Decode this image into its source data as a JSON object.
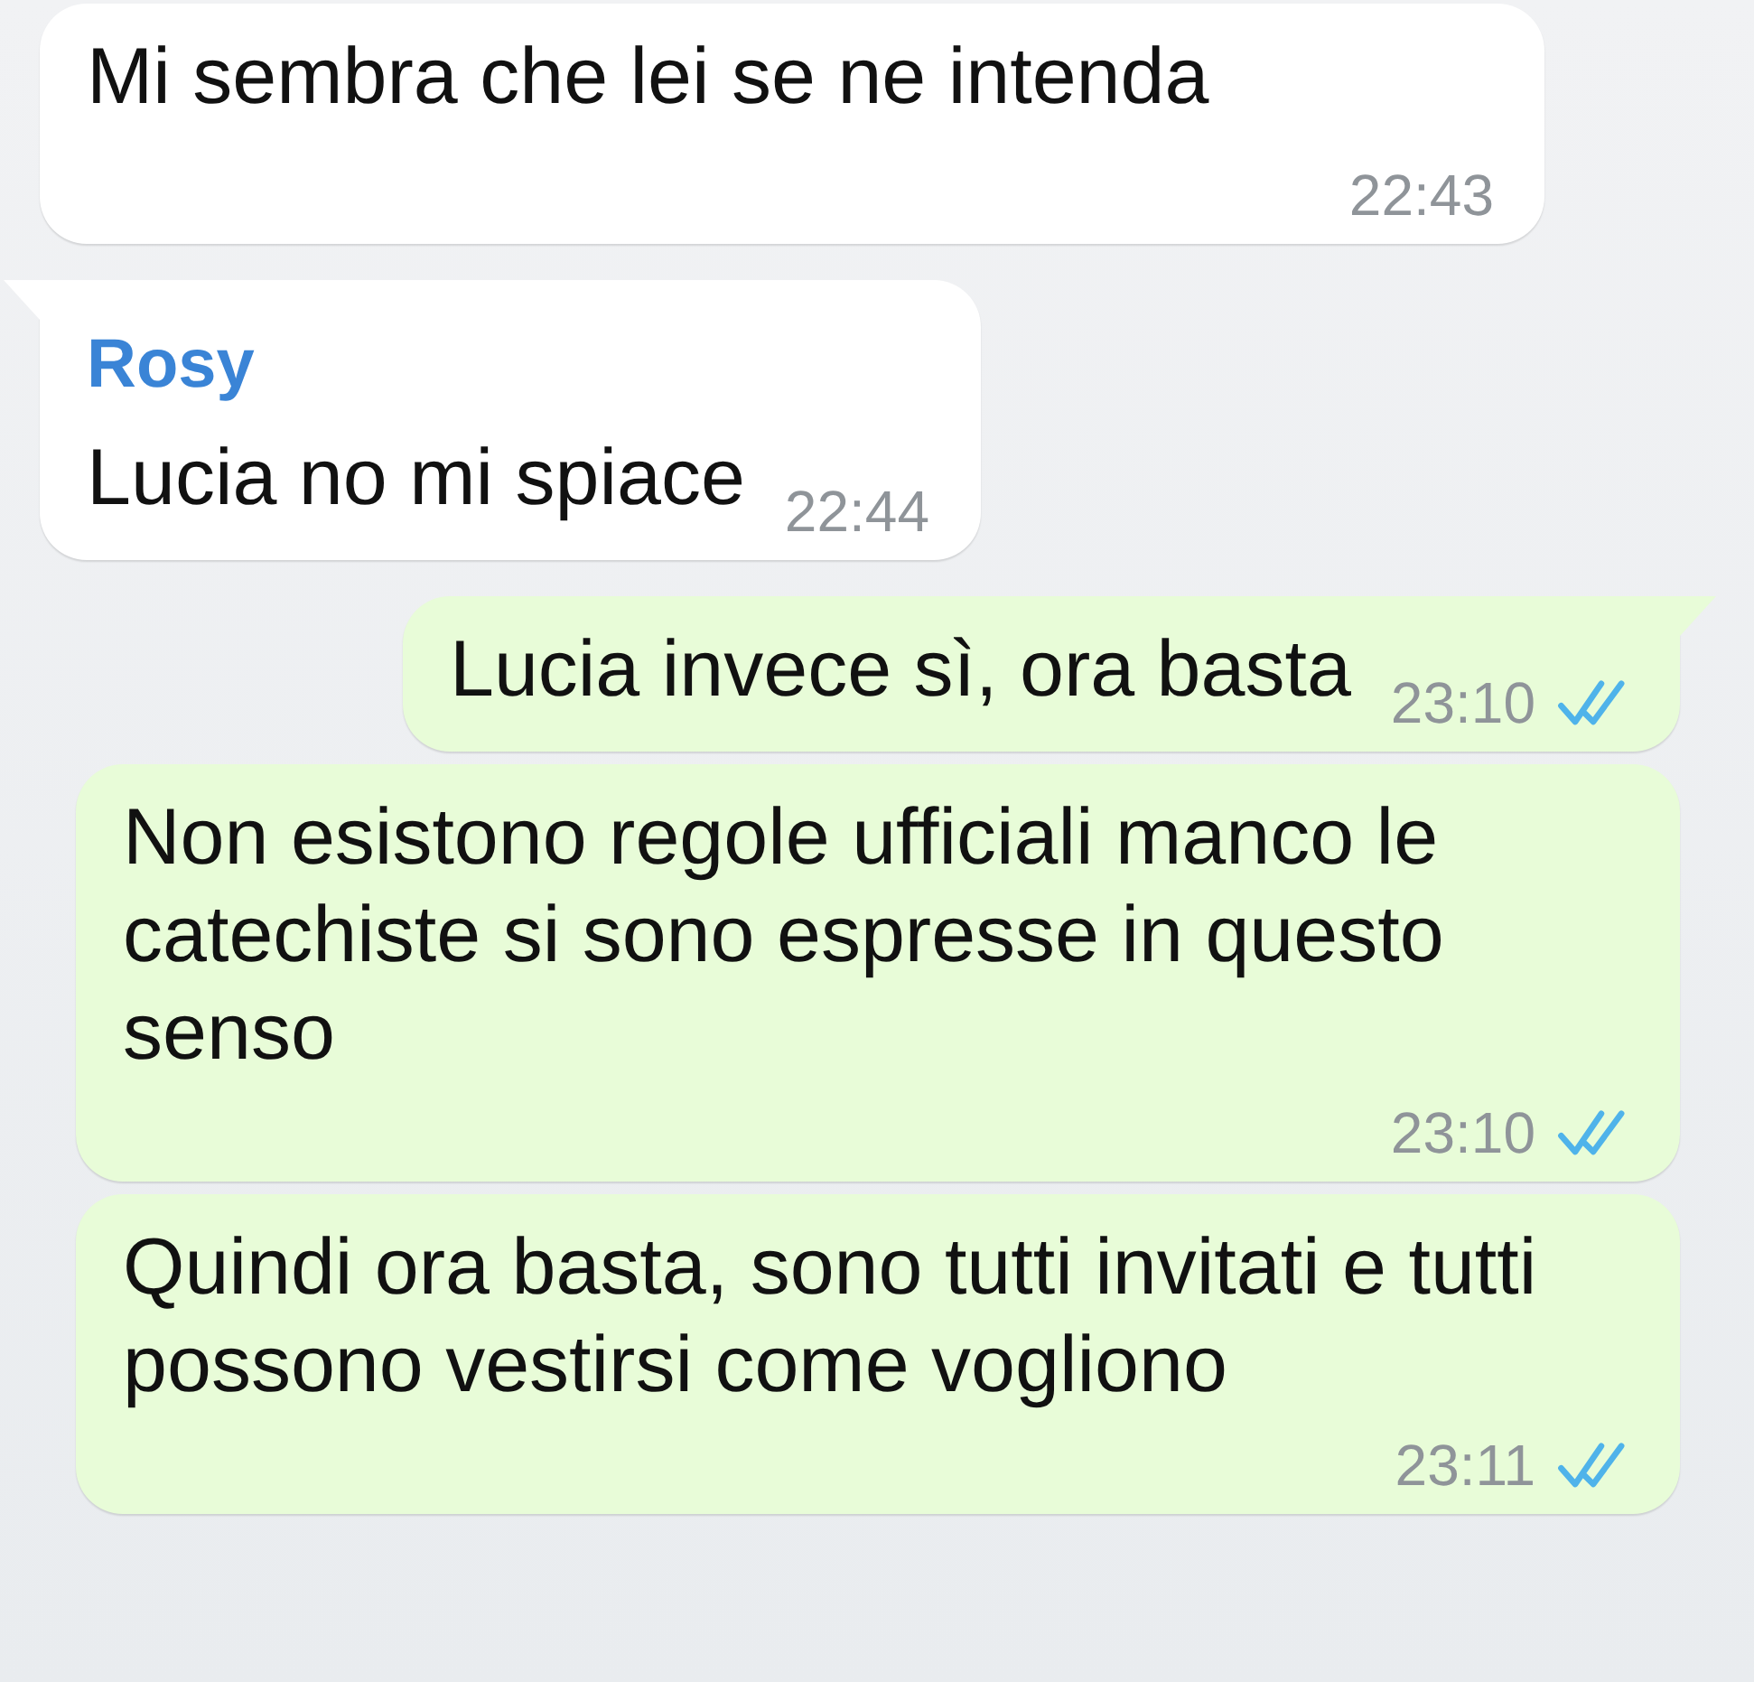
{
  "messages": [
    {
      "outgoing": false,
      "tail": false,
      "text": "Mi sembra che lei se ne intenda",
      "time": "22:43"
    },
    {
      "outgoing": false,
      "tail": true,
      "sender": "Rosy",
      "text": "Lucia no mi spiace",
      "time": "22:44"
    },
    {
      "outgoing": true,
      "tail": true,
      "text": "Lucia invece sì, ora basta",
      "time": "23:10",
      "read": true
    },
    {
      "outgoing": true,
      "tail": false,
      "text": "Non esistono regole ufficiali manco le catechiste si sono espresse in questo senso",
      "time": "23:10",
      "read": true
    },
    {
      "outgoing": true,
      "tail": false,
      "text": "Quindi ora basta, sono tutti invitati e tutti possono vestirsi come vogliono",
      "time": "23:11",
      "read": true
    }
  ]
}
